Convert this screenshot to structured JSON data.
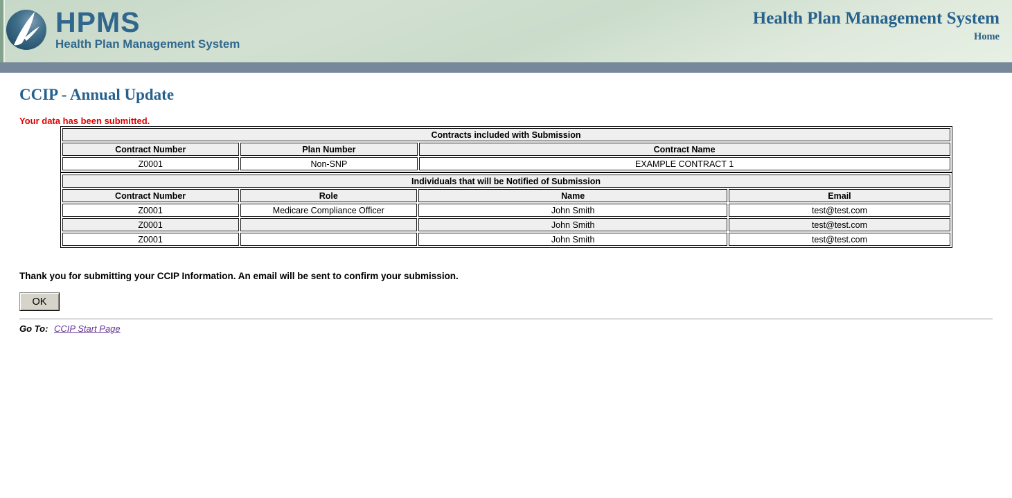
{
  "header": {
    "logo_acronym": "HPMS",
    "logo_tagline": "Health Plan Management System",
    "title": "Health Plan Management System",
    "home_link": "Home"
  },
  "page": {
    "title": "CCIP - Annual Update",
    "status_message": "Your data has been submitted.",
    "thank_you_message": "Thank you for submitting your CCIP Information. An email will be sent to confirm your submission.",
    "ok_button_label": "OK",
    "goto_label": "Go To:",
    "goto_link_label": "CCIP Start Page"
  },
  "contracts_table": {
    "title": "Contracts included with Submission",
    "columns": [
      "Contract Number",
      "Plan Number",
      "Contract Name"
    ],
    "rows": [
      [
        "Z0001",
        "Non-SNP",
        "EXAMPLE CONTRACT 1"
      ]
    ]
  },
  "individuals_table": {
    "title": "Individuals that will be Notified of Submission",
    "columns": [
      "Contract Number",
      "Role",
      "Name",
      "Email"
    ],
    "rows": [
      [
        "Z0001",
        "Medicare Compliance Officer",
        "John Smith",
        "test@test.com"
      ],
      [
        "Z0001",
        "",
        "John Smith",
        "test@test.com"
      ],
      [
        "Z0001",
        "",
        "John Smith",
        "test@test.com"
      ]
    ]
  },
  "colors": {
    "heading_blue": "#26618E",
    "logo_blue": "#31678D",
    "status_red": "#E00000",
    "header_bar": "#77889B",
    "table_header_bg": "#EFEFEF",
    "link_purple": "#663399"
  }
}
